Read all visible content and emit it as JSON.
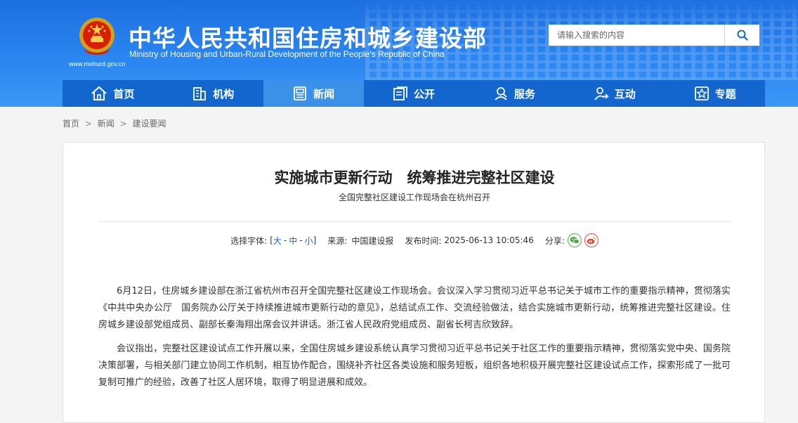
{
  "header": {
    "title_cn": "中华人民共和国住房和城乡建设部",
    "title_en": "Ministry of Housing and Urban-Rural Development of the People’s Republic of China",
    "site_url": "www.mohurd.gov.cn"
  },
  "search": {
    "placeholder": "请输入搜索的内容"
  },
  "nav": [
    {
      "label": "首页",
      "icon": "home-icon"
    },
    {
      "label": "机构",
      "icon": "building-icon"
    },
    {
      "label": "新闻",
      "icon": "news-icon",
      "active": true
    },
    {
      "label": "公开",
      "icon": "document-icon"
    },
    {
      "label": "服务",
      "icon": "service-icon"
    },
    {
      "label": "互动",
      "icon": "interaction-icon"
    },
    {
      "label": "专题",
      "icon": "star-icon"
    }
  ],
  "breadcrumb": {
    "home": "首页",
    "sep": ">",
    "news": "新闻",
    "current": "建设要闻"
  },
  "article": {
    "title": "实施城市更新行动　统筹推进完整社区建设",
    "subtitle": "全国完整社区建设工作现场会在杭州召开",
    "font_label": "选择字体:",
    "font_open": "[",
    "font_large": "大",
    "font_dash": "-",
    "font_medium": "中",
    "font_small": "小",
    "font_close": "]",
    "source_label": "来源:",
    "source": "中国建设报",
    "time_label": "发布时间:",
    "time": "2025-06-13 10:05:46",
    "share_label": "分享:",
    "paragraphs": [
      "6月12日，住房城乡建设部在浙江省杭州市召开全国完整社区建设工作现场会。会议深入学习贯彻习近平总书记关于城市工作的重要指示精神，贯彻落实《中共中央办公厅　国务院办公厅关于持续推进城市更新行动的意见》，总结试点工作、交流经验做法，结合实施城市更新行动，统筹推进完整社区建设。住房城乡建设部党组成员、副部长秦海翔出席会议并讲话。浙江省人民政府党组成员、副省长柯吉欣致辞。",
      "会议指出，完整社区建设试点工作开展以来，全国住房城乡建设系统认真学习贯彻习近平总书记关于社区工作的重要指示精神，贯彻落实党中央、国务院决策部署，与相关部门建立协同工作机制，相互协作配合，围绕补齐社区各类设施和服务短板，组织各地积极开展完整社区建设试点工作，探索形成了一批可复制可推广的经验，改善了社区人居环境，取得了明显进展和成效。"
    ]
  },
  "colors": {
    "header_blue": "#1d6fe0",
    "nav_blue": "#1466cf",
    "nav_active": "#3b90e8",
    "link_blue": "#1466cf",
    "wechat_green": "#4cae4c",
    "weibo_red": "#e24b3b"
  }
}
